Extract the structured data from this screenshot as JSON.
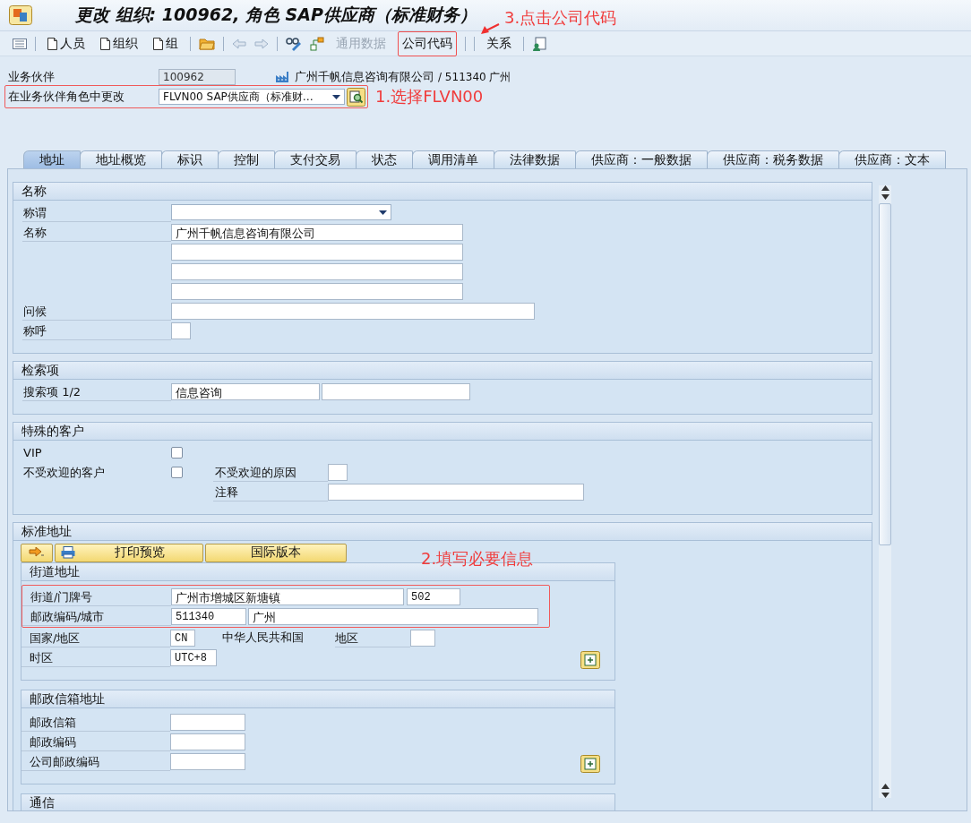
{
  "window": {
    "title": "更改 组织: 100962, 角色 SAP供应商（标准财务）"
  },
  "toolbar": [
    {
      "kind": "doc",
      "label": "人员",
      "disabled": false
    },
    {
      "kind": "doc",
      "label": "组织",
      "disabled": false
    },
    {
      "kind": "doc",
      "label": "组",
      "disabled": false
    },
    {
      "kind": "text",
      "label": "通用数据",
      "disabled": true
    },
    {
      "kind": "text",
      "label": "公司代码",
      "disabled": false
    },
    {
      "kind": "text",
      "label": "关系",
      "disabled": false
    }
  ],
  "header": {
    "partner_label": "业务伙伴",
    "partner": "100962",
    "partner_name": "广州千帆信息咨询有限公司",
    "partner_suffix": "/ 511340 广州",
    "role_label": "在业务伙伴角色中更改",
    "role": "FLVN00 SAP供应商（标准财…"
  },
  "tabs": [
    {
      "label": "地址",
      "selected": true
    },
    {
      "label": "地址概览",
      "selected": false
    },
    {
      "label": "标识",
      "selected": false
    },
    {
      "label": "控制",
      "selected": false
    },
    {
      "label": "支付交易",
      "selected": false
    },
    {
      "label": "状态",
      "selected": false
    },
    {
      "label": "调用清单",
      "selected": false
    },
    {
      "label": "法律数据",
      "selected": false
    },
    {
      "label": "供应商：一般数据",
      "selected": false
    },
    {
      "label": "供应商：税务数据",
      "selected": false
    },
    {
      "label": "供应商：文本",
      "selected": false
    }
  ],
  "name_section": {
    "title": "名称",
    "title_label": "称谓",
    "name_label": "名称",
    "name": "广州千帆信息咨询有限公司",
    "greeting_label": "问候",
    "salutation_label": "称呼"
  },
  "search_section": {
    "title": "检索项",
    "label": "搜索项 1/2",
    "term_1": "信息咨询"
  },
  "special_section": {
    "title": "特殊的客户",
    "vip_label": "VIP",
    "vip_checked": false,
    "unwanted_label": "不受欢迎的客户",
    "unwanted_checked": false,
    "reason_label": "不受欢迎的原因",
    "comment_label": "注释"
  },
  "address_section": {
    "title": "标准地址",
    "print_preview": "打印预览",
    "intl_version": "国际版本",
    "street": {
      "title": "街道地址",
      "street_label": "街道/门牌号",
      "street": "广州市增城区新塘镇",
      "house_no": "502",
      "postal_label": "邮政编码/城市",
      "postal_code": "511340",
      "city": "广州",
      "country_label": "国家/地区",
      "country": "CN",
      "country_name": "中华人民共和国",
      "region_label": "地区",
      "timezone_label": "时区",
      "timezone": "UTC+8"
    },
    "po_box": {
      "title": "邮政信箱地址",
      "box_label": "邮政信箱",
      "postal_label": "邮政编码",
      "company_postal_label": "公司邮政编码"
    },
    "communication": {
      "title": "通信"
    }
  },
  "annotations": [
    {
      "text": "1.选择FLVN00"
    },
    {
      "text": "2.填写必要信息"
    },
    {
      "text": "3.点击公司代码"
    }
  ]
}
